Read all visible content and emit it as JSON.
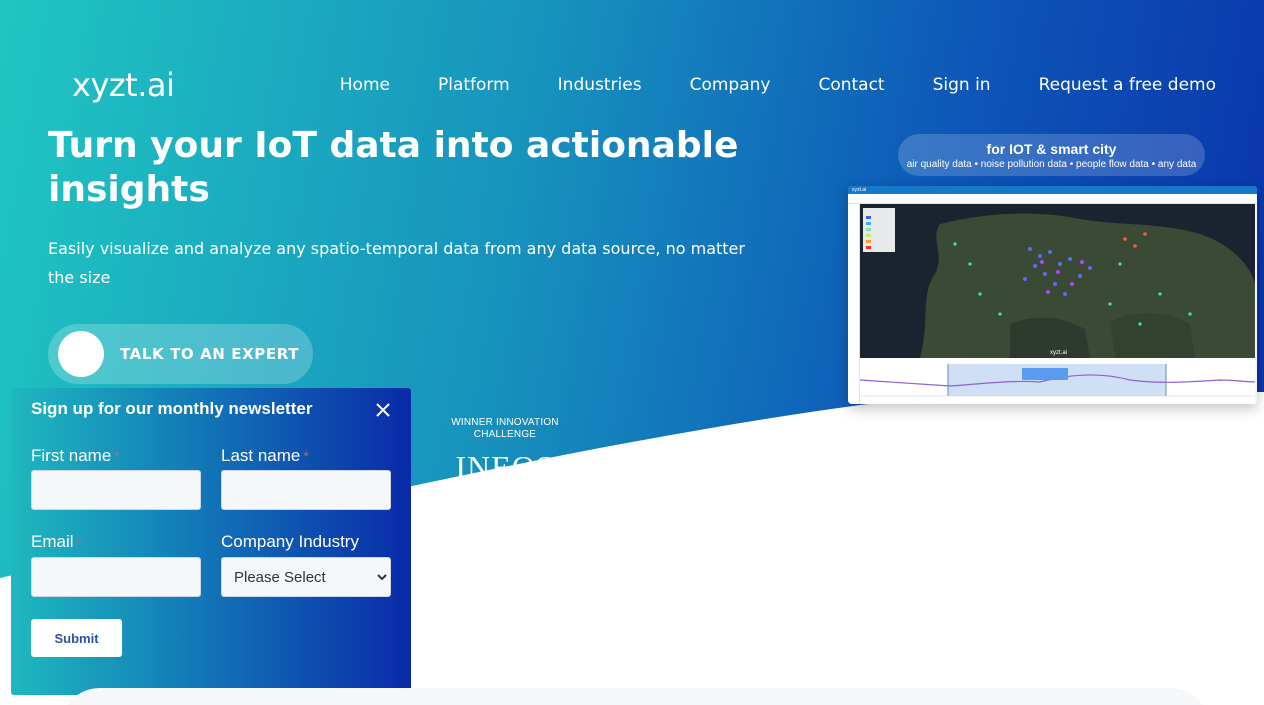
{
  "header": {
    "logo": "xyzt.ai",
    "nav": [
      {
        "label": "Home"
      },
      {
        "label": "Platform"
      },
      {
        "label": "Industries"
      },
      {
        "label": "Company"
      },
      {
        "label": "Contact"
      },
      {
        "label": "Sign in"
      },
      {
        "label": "Request a free demo"
      }
    ]
  },
  "hero": {
    "headline": "Turn your IoT data into actionable insights",
    "subheadline": "Easily visualize and analyze any spatio-temporal data from any data source, no matter the size",
    "cta_label": "TALK TO AN EXPERT",
    "award_text": "WINNER INNOVATION CHALLENGE",
    "award_logo": "INEOS"
  },
  "badge": {
    "title": "for IOT & smart city",
    "subtitle": "air quality data • noise pollution data • people flow data • any data"
  },
  "screenshot": {
    "window_title": "xyzt.ai",
    "map_watermark": "xyzt.ai"
  },
  "newsletter": {
    "title": "Sign up for our monthly newsletter",
    "first_name_label": "First name",
    "last_name_label": "Last name",
    "email_label": "Email",
    "industry_label": "Company Industry",
    "required_marker": "*",
    "industry_selected": "Please Select",
    "submit_label": "Submit"
  },
  "colors": {
    "gradient_start": "#1fc6c2",
    "gradient_end": "#0a2fa9",
    "required": "#ff4b4b",
    "submit_text": "#2b55a3"
  }
}
